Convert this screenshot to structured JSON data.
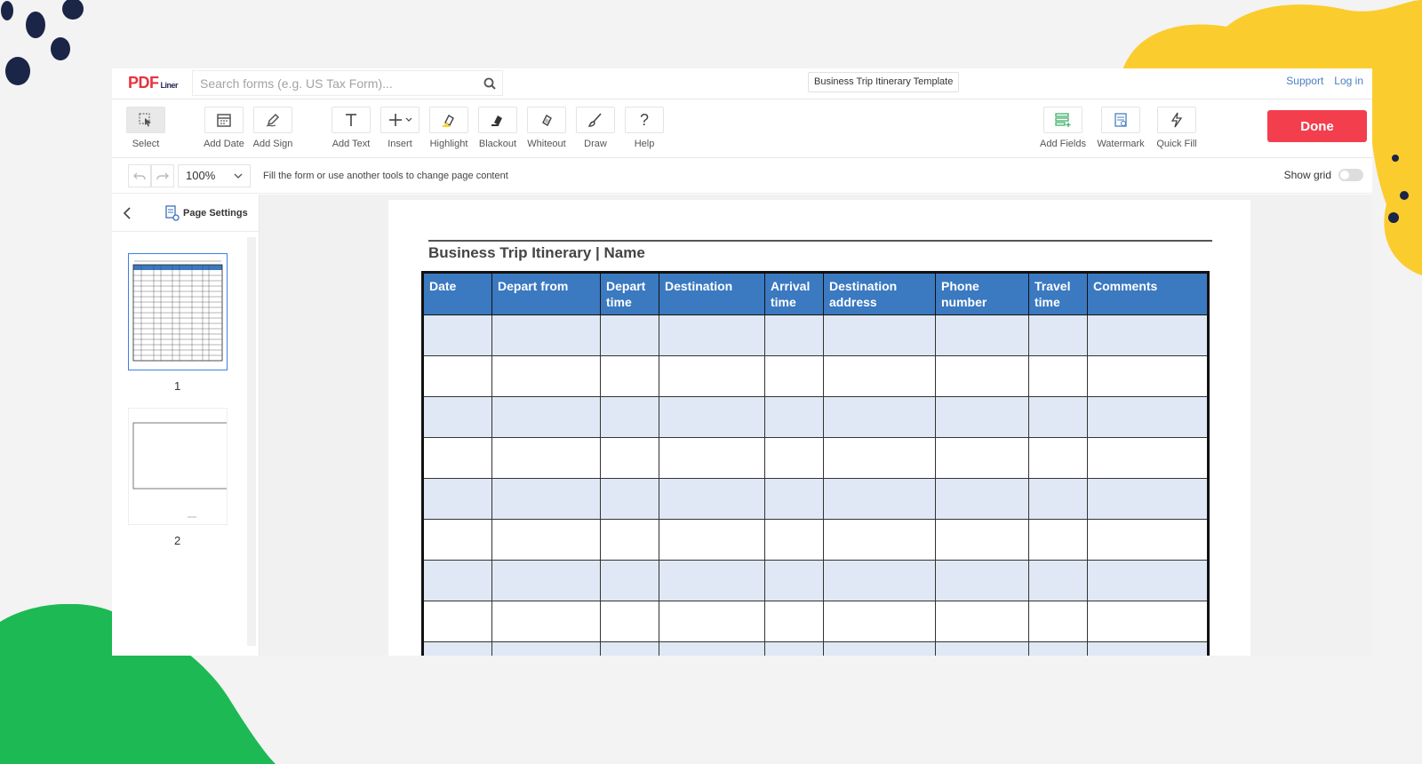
{
  "header": {
    "logo_main": "PDF",
    "logo_sub": "Liner",
    "search_placeholder": "Search forms (e.g. US Tax Form)...",
    "doc_title": "Business Trip Itinerary Template",
    "support": "Support",
    "login": "Log in"
  },
  "toolbar": {
    "tools": [
      {
        "label": "Select",
        "icon": "select-cursor-icon"
      },
      {
        "label": "Add Date",
        "icon": "calendar-icon"
      },
      {
        "label": "Add Sign",
        "icon": "pen-sign-icon"
      },
      {
        "label": "Add Text",
        "icon": "text-t-icon"
      },
      {
        "label": "Insert",
        "icon": "plus-icon"
      },
      {
        "label": "Highlight",
        "icon": "highlighter-icon"
      },
      {
        "label": "Blackout",
        "icon": "blackout-icon"
      },
      {
        "label": "Whiteout",
        "icon": "eraser-icon"
      },
      {
        "label": "Draw",
        "icon": "brush-icon"
      },
      {
        "label": "Help",
        "icon": "question-icon"
      },
      {
        "label": "Add Fields",
        "icon": "fields-icon"
      },
      {
        "label": "Watermark",
        "icon": "watermark-icon"
      },
      {
        "label": "Quick Fill",
        "icon": "lightning-icon"
      }
    ],
    "done": "Done"
  },
  "subbar": {
    "zoom": "100%",
    "hint": "Fill the form or use another tools to change page content",
    "show_grid": "Show grid"
  },
  "sidebar": {
    "page_settings": "Page Settings",
    "pages": [
      "1",
      "2"
    ]
  },
  "document": {
    "title": "Business Trip Itinerary |  Name",
    "columns": [
      "Date",
      "Depart from",
      "Depart time",
      "Destination",
      "Arrival time",
      "Destination address",
      "Phone number",
      "Travel time",
      "Comments"
    ]
  },
  "colors": {
    "accent": "#f33e4d",
    "table_header": "#3b79c0",
    "table_alt_row": "#dfe8f4",
    "link": "#4a7fc1"
  }
}
